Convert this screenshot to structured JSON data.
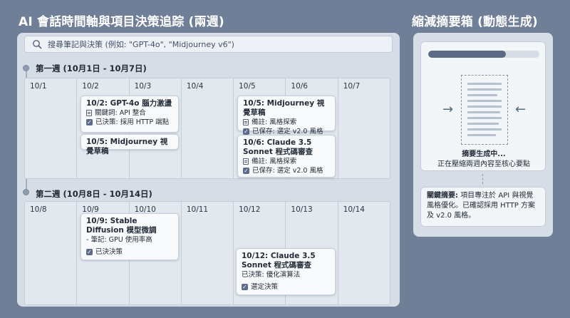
{
  "main": {
    "title": "AI 會話時間軸與項目決策追踪 (兩週)",
    "search_placeholder": "搜尋筆記與決策 (例如: \"GPT-4o\", \"Midjourney v6\")",
    "weeks": [
      {
        "label": "第一週 (10月1日 - 10月7日)",
        "days": [
          "10/1",
          "10/2",
          "10/3",
          "10/4",
          "10/5",
          "10/6",
          "10/7"
        ],
        "cards": [
          {
            "title": "10/2: GPT-4o 腦力激盪",
            "lines": [
              {
                "icon": "note-icon",
                "text": "關鍵詞: API 整合"
              },
              {
                "icon": "check-icon",
                "text": "已決策: 採用 HTTP 端點"
              }
            ]
          },
          {
            "title": "10/5: Midjourney 視覺草稿",
            "lines": []
          },
          {
            "title": "10/5: Midjourney 視覺草稿",
            "lines": [
              {
                "icon": "note-icon",
                "text": "備註: 風格探索"
              },
              {
                "icon": "check-icon",
                "text": "已保存: 選定 v2.0 風格"
              }
            ]
          },
          {
            "title": "10/6: Claude 3.5 Sonnet 程式碼審查",
            "lines": [
              {
                "icon": "note-icon",
                "text": "備註: 風格探索"
              },
              {
                "icon": "check-icon",
                "text": "已保存: 選定 v2.0 風格"
              }
            ]
          }
        ]
      },
      {
        "label": "第二週 (10月8日 - 10月14日)",
        "days": [
          "10/8",
          "10/9",
          "10/10",
          "10/11",
          "10/12",
          "10/13",
          "10/14"
        ],
        "cards": [
          {
            "title": "10/9: Stable Diffusion 模型微調",
            "lines": [
              {
                "icon": "",
                "text": "- 筆記: GPU 使用率高"
              },
              {
                "icon": "check-icon",
                "text": "已決決策"
              }
            ]
          },
          {
            "title": "10/12: Claude 3.5 Sonnet 程式碼審查",
            "lines": [
              {
                "icon": "",
                "text": "已決策: 優化演算法"
              },
              {
                "icon": "check-icon",
                "text": "選定決策"
              }
            ]
          }
        ]
      }
    ]
  },
  "side": {
    "title": "縮減摘要箱 (動態生成)",
    "progress": 0.7,
    "status_line1": "摘要生成中...",
    "status_line2": "正在壓縮兩週內容至核心要點",
    "key_label": "關鍵摘要:",
    "key_text": "項目專注於 API 與視覺風格優化。已確認採用 HTTP 方案及 v2.0 風格。"
  },
  "colors": {
    "background": "#6f7f98",
    "panel": "#d6dde7",
    "card": "#f8fafc",
    "accent": "#5c6b84"
  }
}
